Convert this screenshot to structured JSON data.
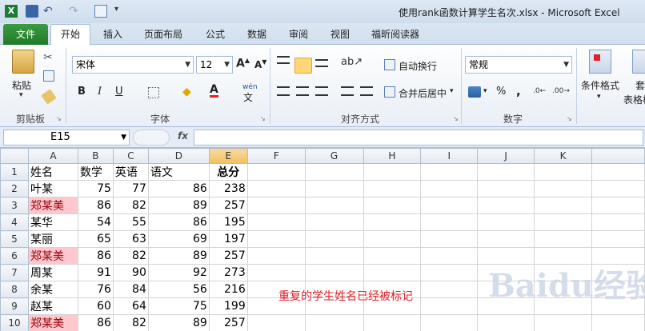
{
  "window": {
    "title": "使用rank函数计算学生名次.xlsx  -  Microsoft Excel"
  },
  "tabs": [
    "文件",
    "开始",
    "插入",
    "页面布局",
    "公式",
    "数据",
    "审阅",
    "视图",
    "福昕阅读器"
  ],
  "ribbon": {
    "clipboard": {
      "paste": "粘贴",
      "label": "剪贴板"
    },
    "font": {
      "name": "宋体",
      "size": "12",
      "bold": "B",
      "italic": "I",
      "underline": "U",
      "wen": "wén",
      "label": "字体"
    },
    "alignment": {
      "wrap": "自动换行",
      "merge": "合并后居中",
      "label": "对齐方式"
    },
    "number": {
      "format": "常规",
      "percent": "%",
      "comma": ",",
      "label": "数字"
    },
    "styles": {
      "cond_format": "条件格式",
      "table_format_1": "套",
      "table_format_2": "表格格"
    }
  },
  "formula_bar": {
    "name_box": "E15",
    "fx": "fx",
    "content": ""
  },
  "grid": {
    "columns": [
      "A",
      "B",
      "C",
      "D",
      "E",
      "F",
      "G",
      "H",
      "I",
      "J",
      "K"
    ],
    "selected_column": "E",
    "rows": [
      {
        "n": "1",
        "a": "姓名",
        "b": "数学",
        "c": "英语",
        "d": "语文",
        "e": "总分",
        "hl": false,
        "header": true
      },
      {
        "n": "2",
        "a": "叶某",
        "b": "75",
        "c": "77",
        "d": "86",
        "e": "238",
        "hl": false
      },
      {
        "n": "3",
        "a": "郑某美",
        "b": "86",
        "c": "82",
        "d": "89",
        "e": "257",
        "hl": true
      },
      {
        "n": "4",
        "a": "某华",
        "b": "54",
        "c": "55",
        "d": "86",
        "e": "195",
        "hl": false
      },
      {
        "n": "5",
        "a": "某丽",
        "b": "65",
        "c": "63",
        "d": "69",
        "e": "197",
        "hl": false
      },
      {
        "n": "6",
        "a": "郑某美",
        "b": "86",
        "c": "82",
        "d": "89",
        "e": "257",
        "hl": true
      },
      {
        "n": "7",
        "a": "周某",
        "b": "91",
        "c": "90",
        "d": "92",
        "e": "273",
        "hl": false
      },
      {
        "n": "8",
        "a": "余某",
        "b": "76",
        "c": "84",
        "d": "56",
        "e": "216",
        "hl": false
      },
      {
        "n": "9",
        "a": "赵某",
        "b": "60",
        "c": "64",
        "d": "75",
        "e": "199",
        "hl": false
      },
      {
        "n": "10",
        "a": "郑某美",
        "b": "86",
        "c": "82",
        "d": "89",
        "e": "257",
        "hl": true
      }
    ]
  },
  "annotation": "重复的学生姓名已经被标记",
  "watermark": "Baidu经验",
  "colors": {
    "file_tab": "#1f7a2a",
    "duplicate_fill": "#ffc7ce",
    "duplicate_text": "#9c0006",
    "annotation": "#e0202a"
  }
}
